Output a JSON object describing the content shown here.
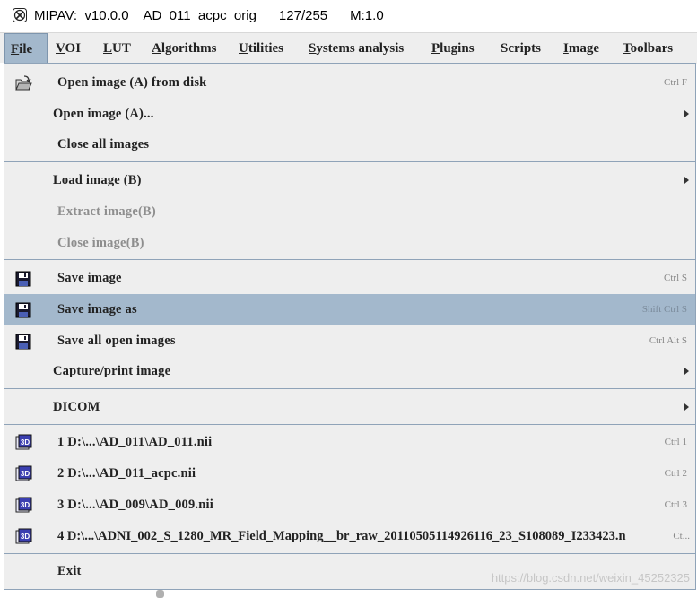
{
  "window": {
    "title": "MIPAV:  v10.0.0    AD_011_acpc_orig      127/255      M:1.0"
  },
  "menubar": {
    "items": [
      {
        "label": "File",
        "mnemonic": "F",
        "rest": "ile"
      },
      {
        "label": "VOI",
        "mnemonic": "V",
        "rest": "OI"
      },
      {
        "label": "LUT",
        "mnemonic": "L",
        "rest": "UT"
      },
      {
        "label": "Algorithms",
        "mnemonic": "A",
        "rest": "lgorithms"
      },
      {
        "label": "Utilities",
        "mnemonic": "U",
        "rest": "tilities"
      },
      {
        "label": "Systems analysis",
        "mnemonic": "S",
        "rest": "ystems analysis"
      },
      {
        "label": "Plugins",
        "mnemonic": "P",
        "rest": "lugins"
      },
      {
        "label": "Scripts",
        "mnemonic": "",
        "rest": "Scripts"
      },
      {
        "label": "Image",
        "mnemonic": "I",
        "rest": "mage"
      },
      {
        "label": "Toolbars",
        "mnemonic": "T",
        "rest": "oolbars"
      }
    ]
  },
  "file_menu": {
    "items": [
      {
        "label": "Open image (A) from disk",
        "shortcut": "Ctrl F",
        "icon": "open-folder-icon"
      },
      {
        "label": "Open image (A)...",
        "submenu": true
      },
      {
        "label": "Close all images"
      },
      {
        "label": "Load image (B)",
        "submenu": true
      },
      {
        "label": "Extract image(B)",
        "disabled": true
      },
      {
        "label": "Close image(B)",
        "disabled": true
      },
      {
        "label": "Save image",
        "shortcut": "Ctrl S",
        "icon": "floppy-disk-icon"
      },
      {
        "label": "Save image as",
        "shortcut": "Shift Ctrl S",
        "icon": "floppy-disk-icon",
        "highlighted": true
      },
      {
        "label": "Save all open images",
        "shortcut": "Ctrl Alt S",
        "icon": "floppy-disk-icon"
      },
      {
        "label": "Capture/print image",
        "submenu": true
      },
      {
        "label": "DICOM",
        "submenu": true
      },
      {
        "label": "1 D:\\...\\AD_011\\AD_011.nii",
        "shortcut": "Ctrl 1",
        "icon": "3d-image-icon"
      },
      {
        "label": "2 D:\\...\\AD_011_acpc.nii",
        "shortcut": "Ctrl 2",
        "icon": "3d-image-icon"
      },
      {
        "label": "3 D:\\...\\AD_009\\AD_009.nii",
        "shortcut": "Ctrl 3",
        "icon": "3d-image-icon"
      },
      {
        "label": "4 D:\\...\\ADNI_002_S_1280_MR_Field_Mapping__br_raw_20110505114926116_23_S108089_I233423.n",
        "shortcut": "Ct...",
        "icon": "3d-image-icon"
      },
      {
        "label": "Exit"
      }
    ]
  },
  "watermark": "https://blog.csdn.net/weixin_45252325",
  "colors": {
    "menu_bg": "#eeeeee",
    "highlight": "#a3b8cc",
    "separator": "#8fa3b8",
    "disabled_text": "#8e8e8e"
  }
}
